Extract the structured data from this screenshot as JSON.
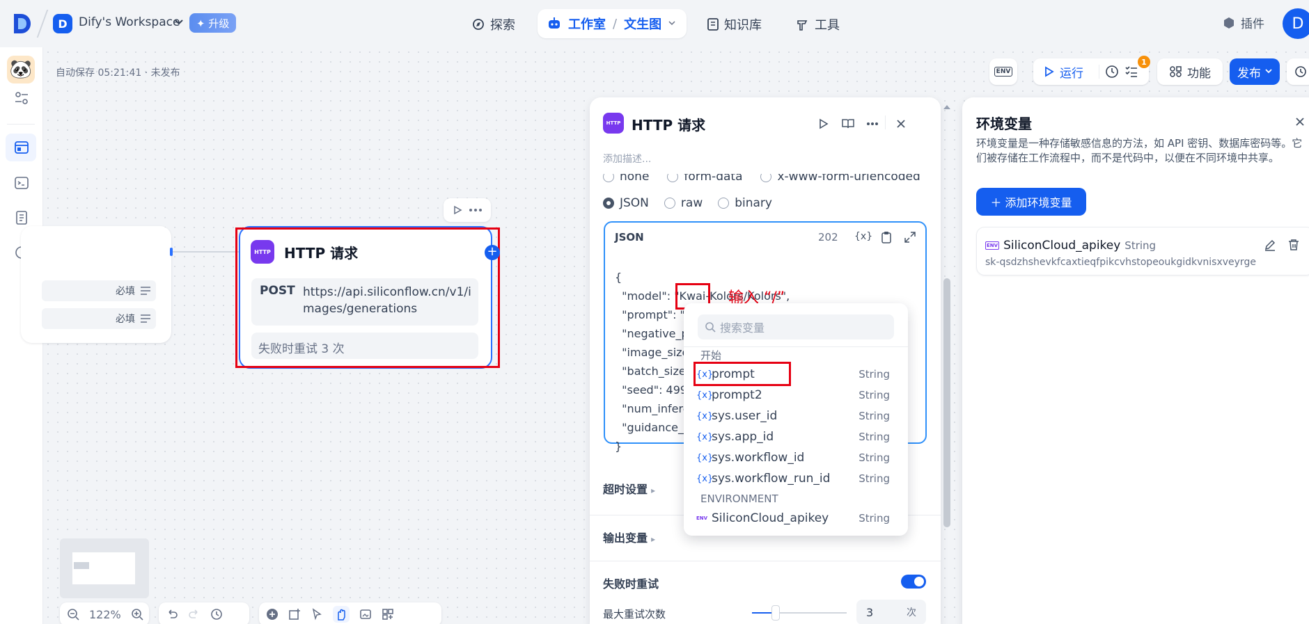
{
  "workspace": {
    "badge": "D",
    "name": "Dify's Workspace",
    "upgrade": "✦ 升级"
  },
  "nav": {
    "explore": "探索",
    "studio": "工作室",
    "app": "文生图",
    "knowledge": "知识库",
    "tools": "工具",
    "plugins": "插件",
    "avatar": "D"
  },
  "canvas": {
    "autosave": "自动保存 05:21:41 · 未发布",
    "start_rows": [
      "必填",
      "必填"
    ],
    "http_node": {
      "icon": "HTTP",
      "title": "HTTP 请求",
      "method": "POST",
      "url": "https://api.siliconflow.cn/v1/images/generations",
      "retry": "失败时重试 3 次"
    },
    "zoom": "122%"
  },
  "toolbar": {
    "env_icon": "ENV",
    "run": "运行",
    "badge": "1",
    "features": "功能",
    "publish": "发布"
  },
  "panel": {
    "title": "HTTP 请求",
    "desc_placeholder": "添加描述...",
    "body_types": [
      "none",
      "form-data",
      "x-www-form-urlencoded",
      "JSON",
      "raw",
      "binary"
    ],
    "json_label": "JSON",
    "json_count": "202",
    "json_lines": [
      "{",
      "  \"model\": \"Kwai-Kolors/Kolors\",",
      "  \"prompt\": \"/|\",",
      "  \"negative_p",
      "  \"image_size",
      "  \"batch_size",
      "  \"seed\": 499",
      "  \"num_infere",
      "  \"guidance_s",
      "}"
    ],
    "annotation": "输入 “/”",
    "timeout": "超时设置",
    "output": "输出变量",
    "retry": "失败时重试",
    "max_retry": "最大重试次数",
    "max_retry_value": "3",
    "max_retry_unit": "次"
  },
  "dropdown": {
    "search_placeholder": "搜索变量",
    "group_start": "开始",
    "group_env": "ENVIRONMENT",
    "items": [
      {
        "name": "prompt",
        "type": "String"
      },
      {
        "name": "prompt2",
        "type": "String"
      },
      {
        "name": "sys.user_id",
        "type": "String"
      },
      {
        "name": "sys.app_id",
        "type": "String"
      },
      {
        "name": "sys.workflow_id",
        "type": "String"
      },
      {
        "name": "sys.workflow_run_id",
        "type": "String"
      }
    ],
    "env_items": [
      {
        "name": "SiliconCloud_apikey",
        "type": "String"
      }
    ]
  },
  "env_panel": {
    "title": "环境变量",
    "description": "环境变量是一种存储敏感信息的方法，如 API 密钥、数据库密码等。它们被存储在工作流程中，而不是代码中，以便在不同环境中共享。",
    "add_button": "＋ 添加环境变量",
    "var_name": "SiliconCloud_apikey",
    "var_type": "String",
    "var_value": "sk-qsdzhshevkfcaxtieqfpikcvhstopeoukgidkvnisxveyrge"
  },
  "colors": {
    "accent": "#155eef",
    "annotation": "#e60012",
    "http": "#7839ee"
  }
}
